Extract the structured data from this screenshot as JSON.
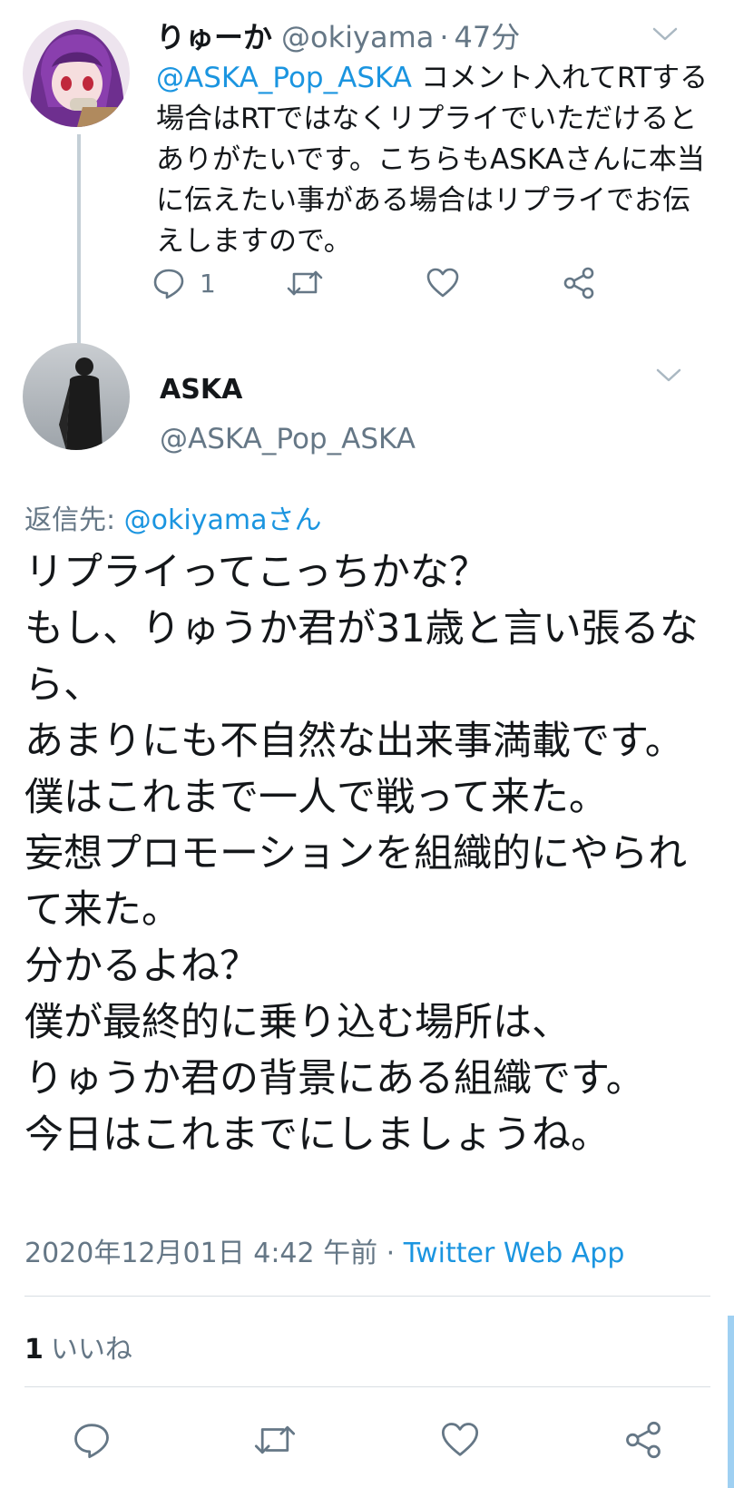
{
  "parent_tweet": {
    "name": "りゅーか",
    "handle": "@okiyama",
    "separator": "·",
    "time": "47分",
    "mention": "@ASKA_Pop_ASKA",
    "text": " コメント入れてRTする場合はRTではなくリプライでいただけるとありがたいです。こちらもASKAさんに本当に伝えたい事がある場合はリプライでお伝えしますので。",
    "reply_count": "1",
    "icons": [
      "reply-icon",
      "retweet-icon",
      "like-icon",
      "share-icon",
      "chevron-down-icon"
    ]
  },
  "main_tweet": {
    "name": "ASKA",
    "handle": "@ASKA_Pop_ASKA",
    "reply_label": "返信先: ",
    "reply_to": "@okiyamaさん",
    "text": "リプライってこっちかな？\nもし、りゅうか君が31歳と言い張るなら、\nあまりにも不自然な出来事満載です。\n僕はこれまで一人で戦って来た。\n妄想プロモーションを組織的にやられて来た。\n分かるよね？\n僕が最終的に乗り込む場所は、\nりゅうか君の背景にある組織です。\n今日はこれまでにしましょうね。",
    "timestamp": "2020年12月01日 4:42 午前",
    "separator": " · ",
    "source_app": "Twitter Web App",
    "like_count": "1",
    "like_label": "いいね",
    "icons": [
      "reply-icon",
      "retweet-icon",
      "like-icon",
      "share-icon",
      "chevron-down-icon"
    ]
  },
  "colors": {
    "link": "#1b95e0",
    "secondary_text": "#657786",
    "primary_text": "#14171a",
    "icon": "#657786",
    "thread_line": "#c4cfd6"
  }
}
